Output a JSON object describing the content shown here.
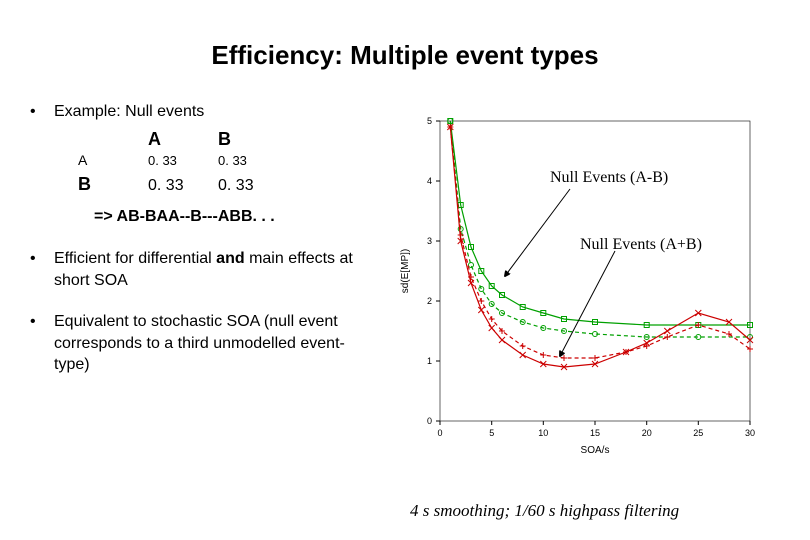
{
  "title": "Efficiency: Multiple event types",
  "bullets": {
    "b1": {
      "lead": "Example: Null events",
      "table": {
        "col_headers": [
          "A",
          "B"
        ],
        "rows": [
          {
            "label": "A",
            "vals": [
              "0. 33",
              "0. 33"
            ]
          },
          {
            "label": "B",
            "vals": [
              "0. 33",
              "0. 33"
            ]
          }
        ]
      },
      "seq": "=> AB-BAA--B---ABB. . ."
    },
    "b2": "Efficient for differential and main effects at short SOA",
    "b3": "Equivalent to stochastic SOA (null event corresponds to a third unmodelled event-type)"
  },
  "chart_annotations": {
    "ylabel": "sd(E[MP])",
    "xlabel": "SOA/s",
    "anno1": "Null Events (A-B)",
    "anno2": "Null Events (A+B)",
    "caption": "4 s smoothing;  1/60 s highpass filtering"
  },
  "chart_data": {
    "type": "line",
    "title": "",
    "xlabel": "SOA/s",
    "ylabel": "sd(E[MP])",
    "xlim": [
      0,
      30
    ],
    "ylim": [
      0,
      5
    ],
    "xticks": [
      0,
      5,
      10,
      15,
      20,
      25,
      30
    ],
    "yticks": [
      0,
      1,
      2,
      3,
      4,
      5
    ],
    "series": [
      {
        "name": "A-B (green, circles, dashed)",
        "color": "#00a000",
        "x": [
          1,
          2,
          3,
          4,
          5,
          6,
          8,
          10,
          12,
          15,
          20,
          25,
          30
        ],
        "y": [
          5.0,
          3.2,
          2.6,
          2.2,
          1.95,
          1.8,
          1.65,
          1.55,
          1.5,
          1.45,
          1.4,
          1.4,
          1.4
        ]
      },
      {
        "name": "A-B null (green, squares, solid)",
        "color": "#00a000",
        "x": [
          1,
          2,
          3,
          4,
          5,
          6,
          8,
          10,
          12,
          15,
          20,
          25,
          30
        ],
        "y": [
          5.0,
          3.6,
          2.9,
          2.5,
          2.25,
          2.1,
          1.9,
          1.8,
          1.7,
          1.65,
          1.6,
          1.6,
          1.6
        ]
      },
      {
        "name": "A+B (red, plus, dashed)",
        "color": "#cc0000",
        "x": [
          1,
          2,
          3,
          4,
          5,
          6,
          8,
          10,
          12,
          15,
          18,
          20,
          22,
          25,
          28,
          30
        ],
        "y": [
          4.9,
          3.1,
          2.4,
          2.0,
          1.7,
          1.5,
          1.25,
          1.1,
          1.05,
          1.05,
          1.15,
          1.25,
          1.4,
          1.6,
          1.45,
          1.2
        ]
      },
      {
        "name": "A+B null (red, x, solid)",
        "color": "#cc0000",
        "x": [
          1,
          2,
          3,
          4,
          5,
          6,
          8,
          10,
          12,
          15,
          18,
          20,
          22,
          25,
          28,
          30
        ],
        "y": [
          4.9,
          3.0,
          2.3,
          1.85,
          1.55,
          1.35,
          1.1,
          0.95,
          0.9,
          0.95,
          1.15,
          1.3,
          1.5,
          1.8,
          1.65,
          1.35
        ]
      }
    ]
  }
}
